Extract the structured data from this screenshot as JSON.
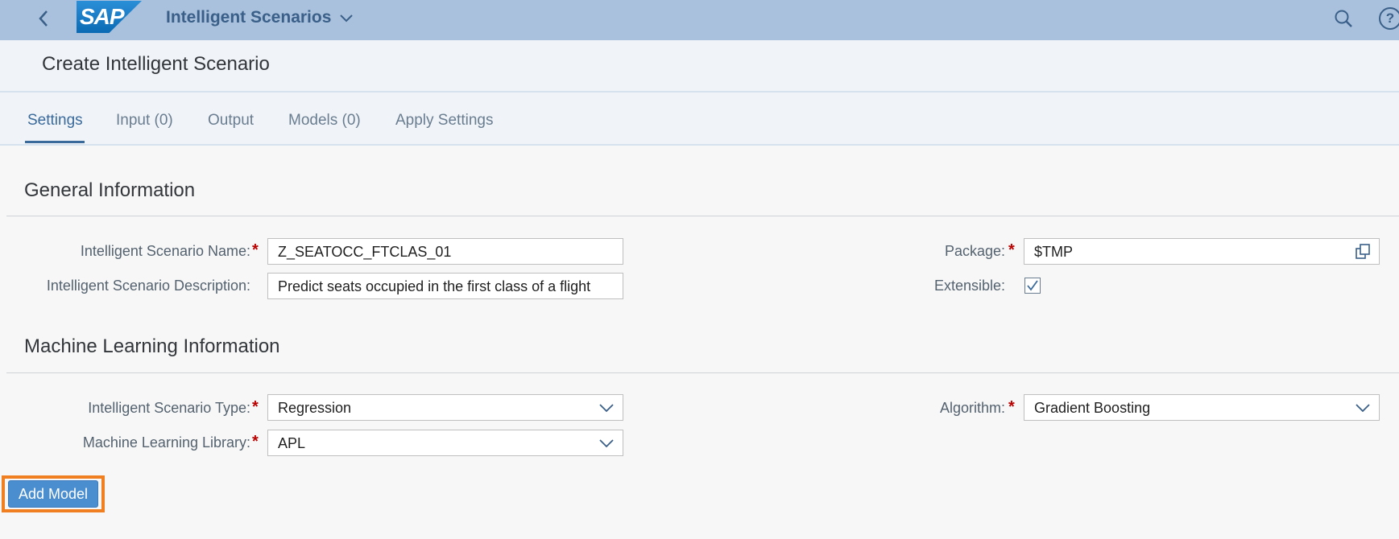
{
  "shell": {
    "logo_text": "SAP",
    "app_title": "Intelligent Scenarios"
  },
  "page": {
    "title": "Create Intelligent Scenario"
  },
  "tabs": [
    {
      "label": "Settings",
      "active": true
    },
    {
      "label": "Input (0)",
      "active": false
    },
    {
      "label": "Output",
      "active": false
    },
    {
      "label": "Models (0)",
      "active": false
    },
    {
      "label": "Apply Settings",
      "active": false
    }
  ],
  "general": {
    "title": "General Information",
    "name_label": "Intelligent Scenario Name:",
    "name_value": "Z_SEATOCC_FTCLAS_01",
    "desc_label": "Intelligent Scenario Description:",
    "desc_value": "Predict seats occupied in the first class of a flight",
    "package_label": "Package:",
    "package_value": "$TMP",
    "extensible_label": "Extensible:",
    "extensible_checked": true
  },
  "ml": {
    "title": "Machine Learning Information",
    "type_label": "Intelligent Scenario Type:",
    "type_value": "Regression",
    "library_label": "Machine Learning Library:",
    "library_value": "APL",
    "algorithm_label": "Algorithm:",
    "algorithm_value": "Gradient Boosting"
  },
  "actions": {
    "add_model": "Add Model"
  },
  "required_marker": "*",
  "colors": {
    "shell": "#a9c1dc",
    "accent": "#3a6a9b",
    "button": "#4a8ecf",
    "highlight": "#f07f22",
    "required": "#bb0000"
  }
}
